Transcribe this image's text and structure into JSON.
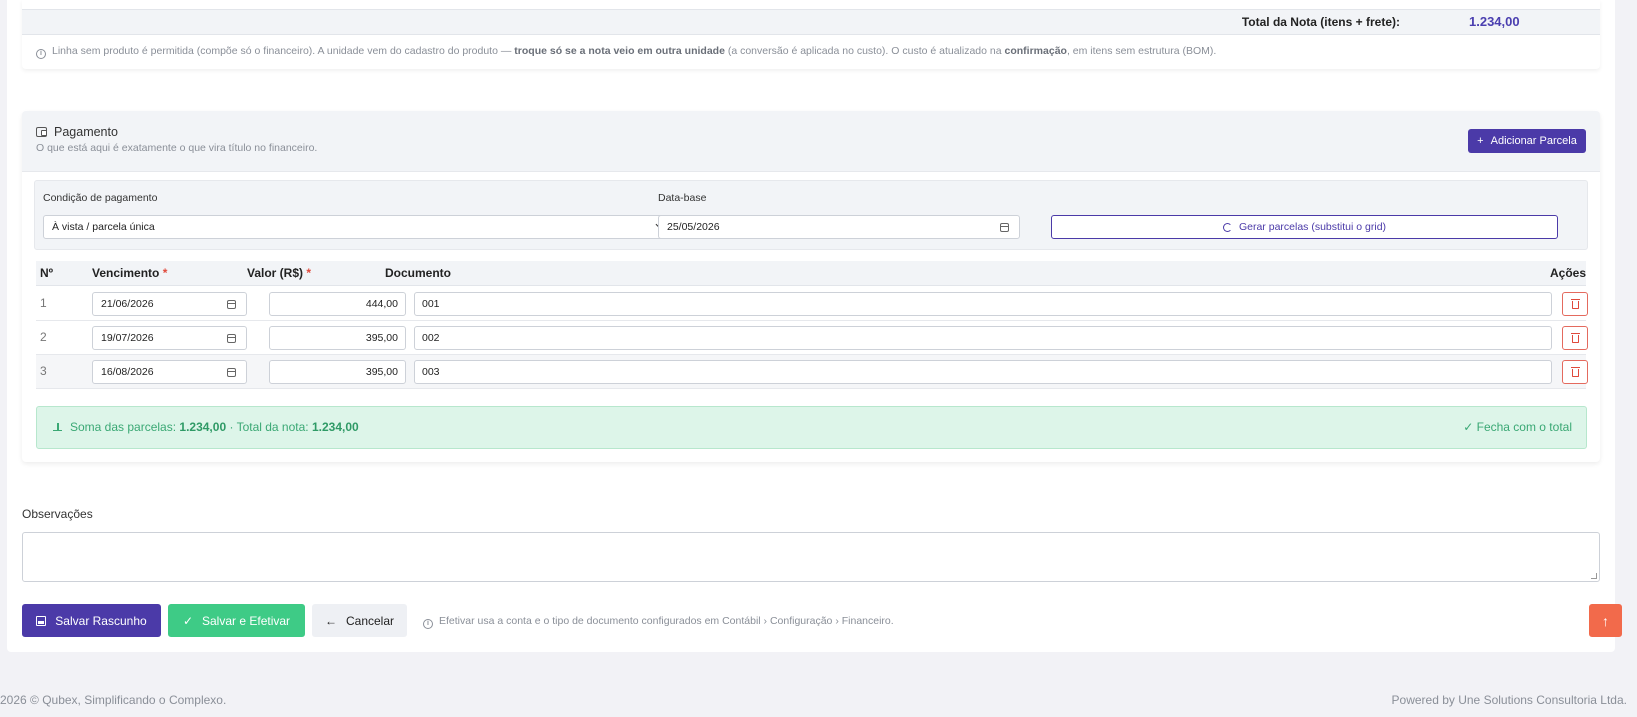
{
  "items": {
    "total_label": "Total da Nota (itens + frete):",
    "total_value": "1.234,00",
    "hint_a": "Linha sem produto é permitida (compõe só o financeiro). A unidade vem do cadastro do produto — ",
    "hint_b": "troque só se a nota veio em outra unidade",
    "hint_c": " (a conversão é aplicada no custo). O custo é atualizado na ",
    "hint_d": "confirmação",
    "hint_e": ", em itens sem estrutura (BOM)."
  },
  "payment": {
    "title": "Pagamento",
    "subtitle": "O que está aqui é exatamente o que vira título no financeiro.",
    "add_button": "Adicionar Parcela",
    "condition_label": "Condição de pagamento",
    "condition_value": "À vista / parcela única",
    "base_date_label": "Data-base",
    "base_date_value": "25/05/2026",
    "generate_button": "Gerar parcelas (substitui o grid)",
    "columns": {
      "n": "Nº",
      "due": "Vencimento",
      "value": "Valor (R$)",
      "document": "Documento",
      "actions": "Ações"
    },
    "installments": [
      {
        "n": "1",
        "due": "21/06/2026",
        "value": "444,00",
        "document": "001"
      },
      {
        "n": "2",
        "due": "19/07/2026",
        "value": "395,00",
        "document": "002"
      },
      {
        "n": "3",
        "due": "16/08/2026",
        "value": "395,00",
        "document": "003"
      }
    ],
    "sum_label": "Soma das parcelas:",
    "sum_value": "1.234,00",
    "sep": " · Total da nota: ",
    "total_value": "1.234,00",
    "status": "Fecha com o total"
  },
  "observations": {
    "label": "Observações",
    "value": ""
  },
  "actions": {
    "draft": "Salvar Rascunho",
    "save": "Salvar e Efetivar",
    "cancel": "Cancelar",
    "hint": "Efetivar usa a conta e o tipo de documento configurados em Contábil › Configuração › Financeiro."
  },
  "footer": {
    "left": "2026 © Qubex, Simplificando o Complexo.",
    "right": "Powered by Une Solutions Consultoria Ltda."
  }
}
